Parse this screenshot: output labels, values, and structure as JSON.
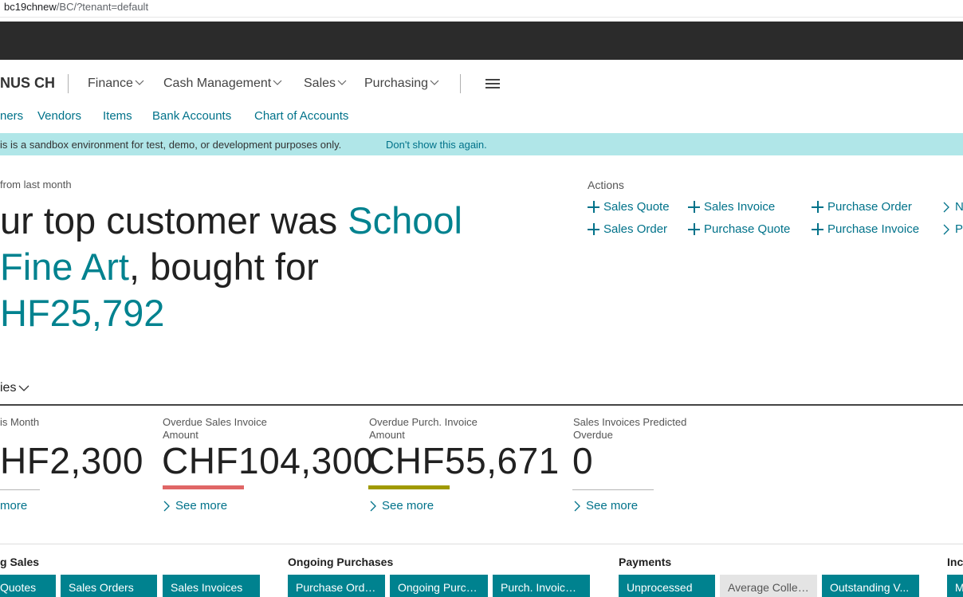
{
  "browser": {
    "url_host": "bc19chnew",
    "url_path": "/BC/?tenant=default"
  },
  "nav": {
    "company": "NUS CH",
    "menus": [
      {
        "label": "Finance"
      },
      {
        "label": "Cash Management"
      },
      {
        "label": "Sales"
      },
      {
        "label": "Purchasing"
      }
    ],
    "quick_links": [
      "ners",
      "Vendors",
      "Items",
      "Bank Accounts",
      "Chart of Accounts"
    ]
  },
  "banner": {
    "text": "is is a sandbox environment for test, demo, or development purposes only.",
    "link": "Don't show this again."
  },
  "insight": {
    "subtitle": "from last month",
    "headline_pre": "ur top customer was ",
    "headline_highlight_1": "School",
    "headline_highlight_2": "Fine Art",
    "headline_mid": ", bought for",
    "headline_amount": "HF25,792"
  },
  "actions": {
    "title": "Actions",
    "items": [
      {
        "label": "Sales Quote",
        "icon": "plus-icon"
      },
      {
        "label": "Sales Invoice",
        "icon": "plus-icon"
      },
      {
        "label": "Purchase Order",
        "icon": "plus-icon"
      },
      {
        "label": "N",
        "icon": "chevron-right-icon"
      },
      {
        "label": "Sales Order",
        "icon": "plus-icon"
      },
      {
        "label": "Purchase Quote",
        "icon": "plus-icon"
      },
      {
        "label": "Purchase Invoice",
        "icon": "plus-icon"
      },
      {
        "label": "P",
        "icon": "chevron-right-icon"
      }
    ]
  },
  "kpis": {
    "section_title": "ies",
    "items": [
      {
        "label": "is Month",
        "value": "HF2,300",
        "more": "more",
        "bar_color": "#b5b5b5"
      },
      {
        "label": "Overdue Sales Invoice Amount",
        "value": "CHF104,300",
        "more": "See more",
        "bar_color": "#e06666"
      },
      {
        "label": "Overdue Purch. Invoice Amount",
        "value": "CHF55,671",
        "more": "See more",
        "bar_color": "#a09a00"
      },
      {
        "label": "Sales Invoices Predicted Overdue",
        "value": "0",
        "more": "See more",
        "bar_color": "#b5b5b5"
      }
    ]
  },
  "tile_groups": [
    {
      "title": "g Sales",
      "tiles": [
        "Quotes",
        "Sales Orders",
        "Sales Invoices"
      ]
    },
    {
      "title": "Ongoing Purchases",
      "tiles": [
        "Purchase Orders",
        "Ongoing Purch...",
        "Purch. Invoices..."
      ]
    },
    {
      "title": "Payments",
      "tiles": [
        "Unprocessed",
        "Average Collec...",
        "Outstanding V..."
      ]
    },
    {
      "title": "Inc",
      "tiles": [
        "M"
      ]
    }
  ]
}
